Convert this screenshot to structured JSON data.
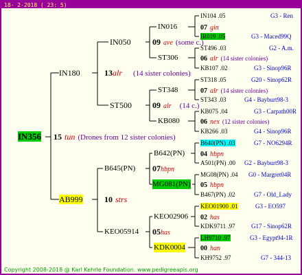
{
  "header": {
    "date": "18-  2-2018 ( 23:  5)"
  },
  "footer": {
    "copyright": "Copyright 2008-2018 @ Karl Kehrle Foundation.   www.pedigreeapis.org"
  },
  "root": {
    "id": "IN356",
    "year": "15",
    "name": "tun",
    "note": "(Drones from 12 sister colonies)",
    "highlight": "#00cc00"
  },
  "g1": {
    "father": {
      "id": "IN180",
      "year": "13",
      "name": "alr",
      "note": "(14 sister colonies)"
    },
    "mother": {
      "id": "AB999",
      "year": "10",
      "name": "strs",
      "highlight": "#ffff00"
    }
  },
  "g2": {
    "ff": {
      "id": "IN050",
      "year": "09",
      "name": "ave",
      "note": "(some c.)"
    },
    "fm": {
      "id": "ST500",
      "year": "09",
      "name": "alr",
      "note": "(14 c.)"
    },
    "mf": {
      "id": "B645(PN)",
      "year": "07",
      "name": "hbpn"
    },
    "mm": {
      "id": "KEO05914",
      "year": "05",
      "name": "has"
    }
  },
  "g3": {
    "fff": {
      "id": "IN016",
      "year": "07",
      "name": "gin"
    },
    "ffm": {
      "id": "ST306",
      "year": "06",
      "name": "alr",
      "note": "(14 sister colonies)"
    },
    "fmf": {
      "id": "ST348",
      "year": "07",
      "name": "alr",
      "note": "(14 sister colonies)"
    },
    "fmm": {
      "id": "KB080",
      "year": "06",
      "name": "nex",
      "note": "(12 sister colonies)"
    },
    "mff": {
      "id": "B642(PN)",
      "year": "04",
      "name": "hbpn"
    },
    "mfm": {
      "id": "MG081(PN)",
      "year": "05",
      "name": "hbpn",
      "highlight": "#00cc00"
    },
    "mmf": {
      "id": "KEO02906",
      "year": "02",
      "name": "has"
    },
    "mmm": {
      "id": "KDK0004",
      "year": "00",
      "name": "han",
      "highlight": "#ffff00"
    }
  },
  "g4": [
    {
      "id": "IN104",
      "year": ".05",
      "loc": "G3 - Ren"
    },
    {
      "id": "IR019",
      "year": ".05",
      "loc": "G3 - Maced99Q",
      "highlight": "#00cc00"
    },
    {
      "id": "ST496",
      "year": ".03",
      "loc": "G2 - A.m."
    },
    {
      "id": "KB107",
      "year": ".02",
      "loc": "G3 - Sinop96R"
    },
    {
      "id": "ST318",
      "year": ".05",
      "loc": "G20 - Sinop62R"
    },
    {
      "id": "ST343",
      "year": ".03",
      "loc": "G4 - Bayburt98-3"
    },
    {
      "id": "KB075",
      "year": ".04",
      "loc": "G3 - Carpath00R"
    },
    {
      "id": "KB266",
      "year": ".03",
      "loc": "G4 - Sinop96R"
    },
    {
      "id": "B640(PN)",
      "year": ".03",
      "loc": "G7 - NO6294R",
      "highlight": "#00ffff"
    },
    {
      "id": "A501(PN)",
      "year": ".00",
      "loc": "G2 - Bayburt98-3"
    },
    {
      "id": "MG08(PN)",
      "year": ".04",
      "loc": "G0 - Margret04R"
    },
    {
      "id": "B467(PN)",
      "year": ".02",
      "loc": "G7 - Old_Lady"
    },
    {
      "id": "KEO01900",
      "year": ".01",
      "loc": "G3 - EO597",
      "highlight": "#ffff00"
    },
    {
      "id": "KDK9711",
      "year": ".97",
      "loc": "G17 - Sinop62R"
    },
    {
      "id": "LH9710",
      "year": ".97",
      "loc": "G3 - Egypt94-1R",
      "highlight": "#00cc00"
    },
    {
      "id": "KH9752",
      "year": ".97",
      "loc": "G7 - 344-13"
    }
  ],
  "colors": {
    "frame": "#990099",
    "lines": "#000000",
    "queen_name": "#cc0000",
    "note": "#660099",
    "location": "#0000cc",
    "footer": "#009900"
  }
}
